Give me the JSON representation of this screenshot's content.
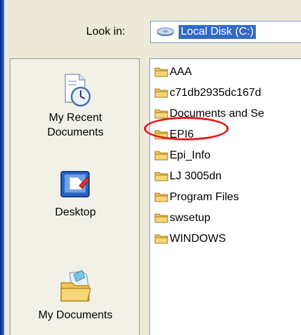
{
  "dialog": {
    "look_in_label": "Look in:",
    "look_in_value": "Local Disk (C:)",
    "look_in_icon": "drive-icon"
  },
  "places": [
    {
      "label_line1": "My Recent",
      "label_line2": "Documents",
      "icon": "recent-documents-icon"
    },
    {
      "label_line1": "Desktop",
      "label_line2": "",
      "icon": "desktop-icon"
    },
    {
      "label_line1": "My Documents",
      "label_line2": "",
      "icon": "my-documents-icon"
    }
  ],
  "files": [
    {
      "name": "AAA"
    },
    {
      "name": "c71db2935dc167d"
    },
    {
      "name": "Documents and Se"
    },
    {
      "name": "EPI6"
    },
    {
      "name": "Epi_Info"
    },
    {
      "name": "LJ 3005dn"
    },
    {
      "name": "Program Files"
    },
    {
      "name": "swsetup"
    },
    {
      "name": "WINDOWS"
    }
  ],
  "annotation": {
    "highlighted_item": "EPI6",
    "color": "#e21a1a"
  },
  "colors": {
    "selection": "#316ac5",
    "dialog_bg": "#ece9d8",
    "folder": "#f5c64c"
  }
}
